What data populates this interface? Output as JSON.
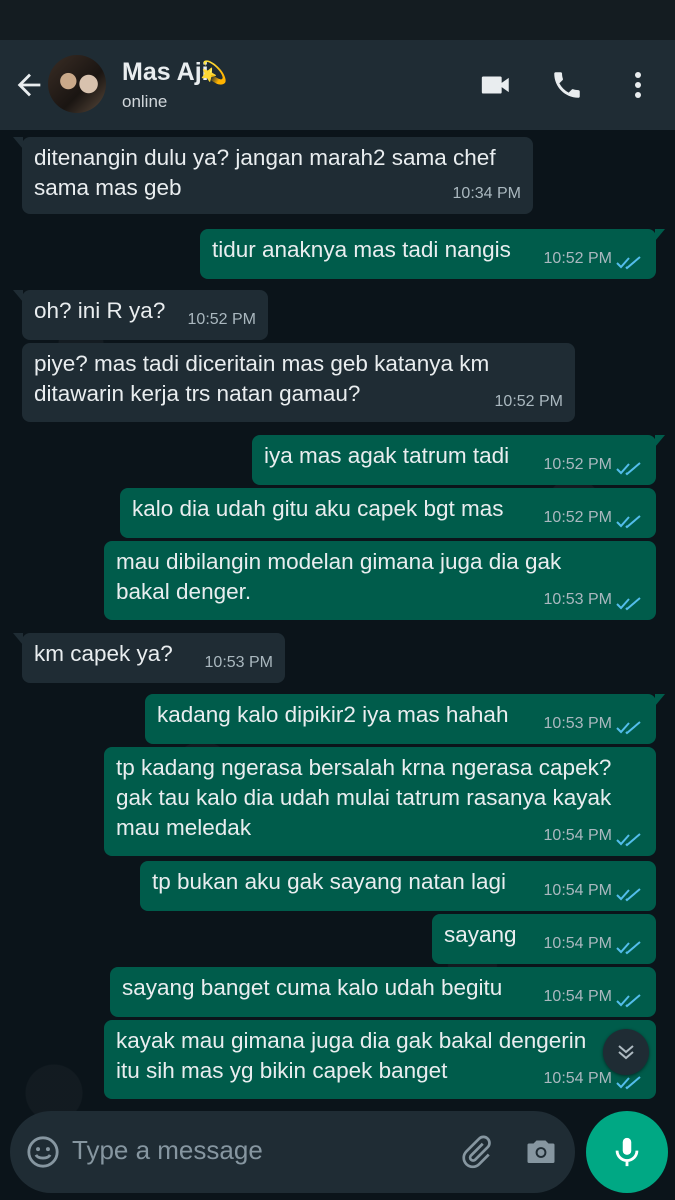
{
  "header": {
    "contact_name": "Mas Aji",
    "name_emoji": "💫",
    "presence": "online"
  },
  "icons": {
    "back": "arrow-left-icon",
    "video": "video-call-icon",
    "voice": "phone-icon",
    "menu": "more-vertical-icon",
    "scroll": "chevron-down-icon",
    "emoji": "emoji-icon",
    "attach": "paperclip-icon",
    "camera": "camera-icon",
    "mic": "mic-icon"
  },
  "colors": {
    "header_bg": "#1f2c34",
    "incoming_bubble": "#1f2c34",
    "outgoing_bubble": "#005c4b",
    "read_ticks": "#53bdeb",
    "mic_button": "#00a884"
  },
  "messages": [
    {
      "dir": "in",
      "text": "ditenangin dulu ya? jangan marah2 sama chef\nsama mas geb",
      "time": "10:34 PM"
    },
    {
      "dir": "out",
      "text": "tidur anaknya mas tadi nangis",
      "time": "10:52 PM",
      "read": true
    },
    {
      "dir": "in",
      "text": "oh? ini R ya?",
      "time": "10:52 PM"
    },
    {
      "dir": "in",
      "text": "piye? mas tadi diceritain mas geb katanya km\nditawarin kerja trs natan gamau?",
      "time": "10:52 PM"
    },
    {
      "dir": "out",
      "text": "iya mas agak tatrum tadi",
      "time": "10:52 PM",
      "read": true
    },
    {
      "dir": "out",
      "text": "kalo dia udah gitu aku capek bgt mas",
      "time": "10:52 PM",
      "read": true
    },
    {
      "dir": "out",
      "text": "mau dibilangin modelan gimana juga dia gak\nbakal denger.",
      "time": "10:53 PM",
      "read": true
    },
    {
      "dir": "in",
      "text": "km capek ya?",
      "time": "10:53 PM"
    },
    {
      "dir": "out",
      "text": "kadang kalo dipikir2 iya mas hahah",
      "time": "10:53 PM",
      "read": true
    },
    {
      "dir": "out",
      "text": "tp kadang ngerasa bersalah krna ngerasa capek?\ngak tau kalo dia udah mulai tatrum rasanya kayak\nmau meledak",
      "time": "10:54 PM",
      "read": true
    },
    {
      "dir": "out",
      "text": "tp bukan aku gak sayang natan lagi",
      "time": "10:54 PM",
      "read": true
    },
    {
      "dir": "out",
      "text": "sayang",
      "time": "10:54 PM",
      "read": true
    },
    {
      "dir": "out",
      "text": "sayang banget cuma kalo udah begitu",
      "time": "10:54 PM",
      "read": true
    },
    {
      "dir": "out",
      "text": "kayak mau gimana juga dia gak bakal dengerin\nitu sih mas yg bikin capek banget",
      "time": "10:54 PM",
      "read": true
    }
  ],
  "composer": {
    "placeholder": "Type a message"
  }
}
